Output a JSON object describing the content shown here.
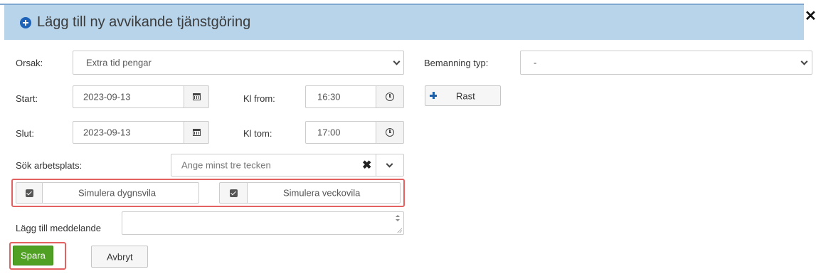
{
  "dialog": {
    "title": "Lägg till ny avvikande tjänstgöring",
    "close_symbol": "✕"
  },
  "form": {
    "orsak_label": "Orsak:",
    "orsak_value": "Extra tid pengar",
    "bemanning_label": "Bemanning typ:",
    "bemanning_value": "-",
    "start_label": "Start:",
    "start_date": "2023-09-13",
    "kl_from_label": "Kl from:",
    "kl_from_value": "16:30",
    "rast_label": "Rast",
    "slut_label": "Slut:",
    "slut_date": "2023-09-13",
    "kl_tom_label": "Kl tom:",
    "kl_tom_value": "17:00",
    "arbetsplats_label": "Sök arbetsplats:",
    "arbetsplats_placeholder": "Ange minst tre tecken",
    "clear_symbol": "✖",
    "simulera_dygnsvila_label": "Simulera dygnsvila",
    "simulera_dygnsvila_checked": true,
    "simulera_veckovila_label": "Simulera veckovila",
    "simulera_veckovila_checked": true,
    "meddelande_label": "Lägg till meddelande",
    "meddelande_value": ""
  },
  "actions": {
    "save_label": "Spara",
    "cancel_label": "Avbryt"
  },
  "colors": {
    "header_bg": "#b8d4ea",
    "save_green": "#4fa023",
    "highlight_red": "#e46161",
    "accent_blue": "#1e63b8"
  },
  "icons": {
    "header": "plus-circle-icon",
    "date": "calendar-icon",
    "time": "clock-icon",
    "dropdown": "chevron-down-icon",
    "add": "plus-icon",
    "clear": "x-icon",
    "close": "close-icon",
    "checkbox": "checkbox-checked-icon"
  }
}
